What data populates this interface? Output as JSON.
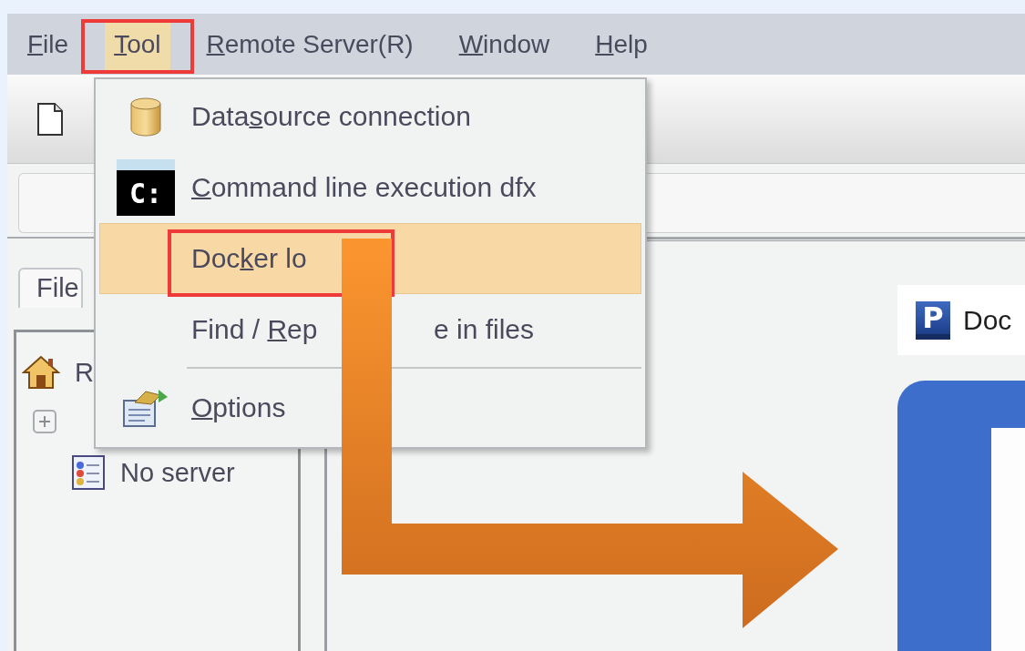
{
  "menubar": [
    {
      "label": "File",
      "selected": false
    },
    {
      "label": "Tool",
      "selected": true
    },
    {
      "label": "Remote Server(R)",
      "selected": false
    },
    {
      "label": "Window",
      "selected": false
    },
    {
      "label": "Help",
      "selected": false
    }
  ],
  "tool_menu": {
    "items": [
      {
        "kind": "item",
        "label": "Datasource connection",
        "selected": false
      },
      {
        "kind": "item",
        "icon_text": "C:",
        "label": "Command line execution dfx",
        "selected": false
      },
      {
        "kind": "item",
        "label": "Docker lo",
        "selected": true
      },
      {
        "kind": "item",
        "label": "Find / Rep",
        "label_after": "e in files",
        "selected": false
      },
      {
        "kind": "separator"
      },
      {
        "kind": "item",
        "label": "Options",
        "selected": false
      }
    ]
  },
  "left_panel": {
    "tab": "File",
    "tree": [
      {
        "label": "R",
        "children": [
          {
            "expanded": false
          },
          {
            "label": "No server"
          }
        ]
      }
    ]
  },
  "preview": {
    "logo_text": "P",
    "title": "Doc"
  }
}
